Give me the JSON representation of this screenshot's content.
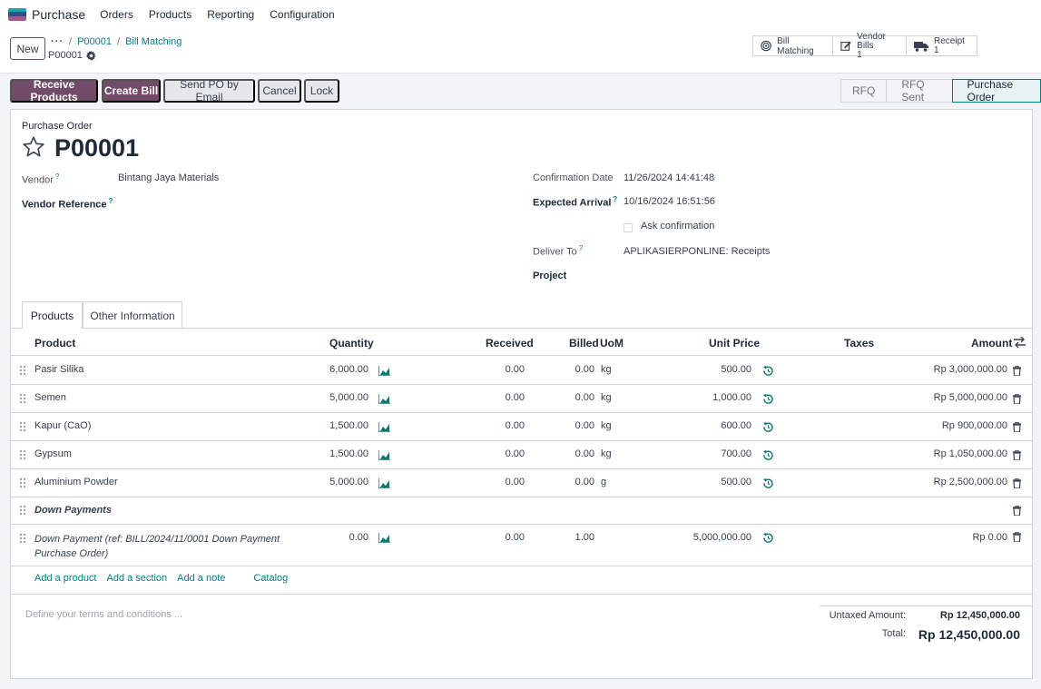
{
  "topnav": {
    "app_name": "Purchase",
    "menu": [
      "Orders",
      "Products",
      "Reporting",
      "Configuration"
    ]
  },
  "control": {
    "new_label": "New",
    "breadcrumb_dots": "···",
    "breadcrumb": [
      "P00001",
      "Bill Matching"
    ],
    "record_ref": "P00001",
    "stats": {
      "bill_matching": "Bill Matching",
      "vendor_bills_label": "Vendor Bills",
      "vendor_bills_count": "1",
      "receipt_label": "Receipt",
      "receipt_count": "1"
    }
  },
  "actions": {
    "receive": "Receive Products",
    "create_bill": "Create Bill",
    "send_po": "Send PO by Email",
    "cancel": "Cancel",
    "lock": "Lock"
  },
  "statusbar": [
    "RFQ",
    "RFQ Sent",
    "Purchase Order"
  ],
  "form": {
    "record_label": "Purchase Order",
    "record_name": "P00001",
    "vendor_label": "Vendor",
    "vendor_value": "Bintang Jaya Materials",
    "vendor_ref_label": "Vendor Reference",
    "help_mark": "?",
    "confirmation_label": "Confirmation Date",
    "confirmation_value": "11/26/2024 14:41:48",
    "expected_label": "Expected Arrival",
    "expected_value": "10/16/2024 16:51:56",
    "ask_confirmation": "Ask confirmation",
    "deliver_label": "Deliver To",
    "deliver_value": "APLIKASIERPONLINE: Receipts",
    "project_label": "Project"
  },
  "tabs": [
    "Products",
    "Other Information"
  ],
  "table": {
    "headers": {
      "product": "Product",
      "quantity": "Quantity",
      "received": "Received",
      "billed": "Billed",
      "uom": "UoM",
      "unit_price": "Unit Price",
      "taxes": "Taxes",
      "amount": "Amount"
    },
    "rows": [
      {
        "product": "Pasir Silika",
        "quantity": "6,000.00",
        "received": "0.00",
        "billed": "0.00",
        "uom": "kg",
        "unit_price": "500.00",
        "amount": "Rp 3,000,000.00"
      },
      {
        "product": "Semen",
        "quantity": "5,000.00",
        "received": "0.00",
        "billed": "0.00",
        "uom": "kg",
        "unit_price": "1,000.00",
        "amount": "Rp 5,000,000.00"
      },
      {
        "product": "Kapur (CaO)",
        "quantity": "1,500.00",
        "received": "0.00",
        "billed": "0.00",
        "uom": "kg",
        "unit_price": "600.00",
        "amount": "Rp 900,000.00"
      },
      {
        "product": "Gypsum",
        "quantity": "1,500.00",
        "received": "0.00",
        "billed": "0.00",
        "uom": "kg",
        "unit_price": "700.00",
        "amount": "Rp 1,050,000.00"
      },
      {
        "product": "Aluminium Powder",
        "quantity": "5,000.00",
        "received": "0.00",
        "billed": "0.00",
        "uom": "g",
        "unit_price": "500.00",
        "amount": "Rp 2,500,000.00"
      }
    ],
    "section": "Down Payments",
    "dp_row": {
      "product_line1": "Down Payment (ref: BILL/2024/11/0001 Down Payment",
      "product_line2": "Purchase Order)",
      "quantity": "0.00",
      "received": "0.00",
      "billed": "1.00",
      "unit_price": "5,000,000.00",
      "amount": "Rp 0.00"
    },
    "add_links": [
      "Add a product",
      "Add a section",
      "Add a note",
      "Catalog"
    ]
  },
  "footer": {
    "terms_placeholder": "Define your terms and conditions ...",
    "untaxed_label": "Untaxed Amount:",
    "untaxed_value": "Rp 12,450,000.00",
    "total_label": "Total:",
    "total_value": "Rp 12,450,000.00"
  },
  "colors": {
    "primary": "#714b67",
    "link": "#017e84",
    "icon_teal": "#0f766e"
  }
}
